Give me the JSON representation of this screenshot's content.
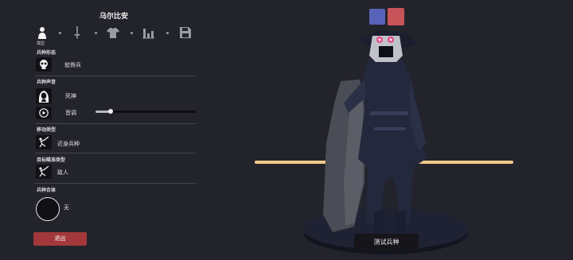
{
  "unit": {
    "title": "乌尔比安"
  },
  "tabs": [
    {
      "icon": "person-icon",
      "label": "模型"
    },
    {
      "icon": "sword-icon"
    },
    {
      "icon": "shirt-icon"
    },
    {
      "icon": "bars-icon"
    },
    {
      "icon": "save-icon"
    }
  ],
  "form_section": {
    "label": "兵种形态",
    "value": "软骨兵",
    "icon": "skull-icon"
  },
  "voice_section": {
    "label": "兵种声音",
    "voice_value": "死神",
    "voice_icon": "reaper-icon",
    "pitch_label": "音调",
    "pitch_icon": "play-icon",
    "pitch_level": 0.15
  },
  "movement_section": {
    "label": "移动类型",
    "value": "近身兵种",
    "icon": "melee-icon"
  },
  "targeting_section": {
    "label": "目标瞄准类型",
    "value": "敌人",
    "icon": "target-icon"
  },
  "fusion_section": {
    "label": "兵种合体",
    "value": "无"
  },
  "buttons": {
    "exit": "退出",
    "test": "测试兵种"
  },
  "team_colors": [
    "#5862b8",
    "#c8545a"
  ]
}
